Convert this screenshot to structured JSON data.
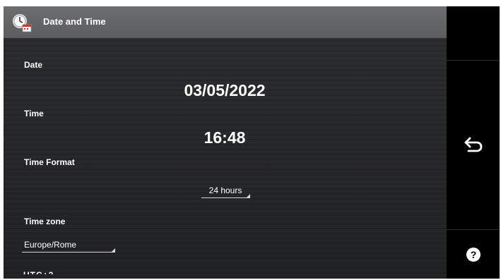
{
  "header": {
    "title": "Date and Time",
    "icon": "clock-calendar-icon"
  },
  "date": {
    "label": "Date",
    "value": "03/05/2022"
  },
  "time": {
    "label": "Time",
    "value": "16:48"
  },
  "time_format": {
    "label": "Time Format",
    "selected": "24 hours"
  },
  "time_zone": {
    "label": "Time zone",
    "selected": "Europe/Rome"
  },
  "side_buttons": {
    "back_icon": "back-arrow-icon",
    "help_icon": "help-icon"
  },
  "colors": {
    "titlebar": "#5f6062",
    "background": "#232426",
    "side_panel": "#000000",
    "text": "#ffffff"
  }
}
